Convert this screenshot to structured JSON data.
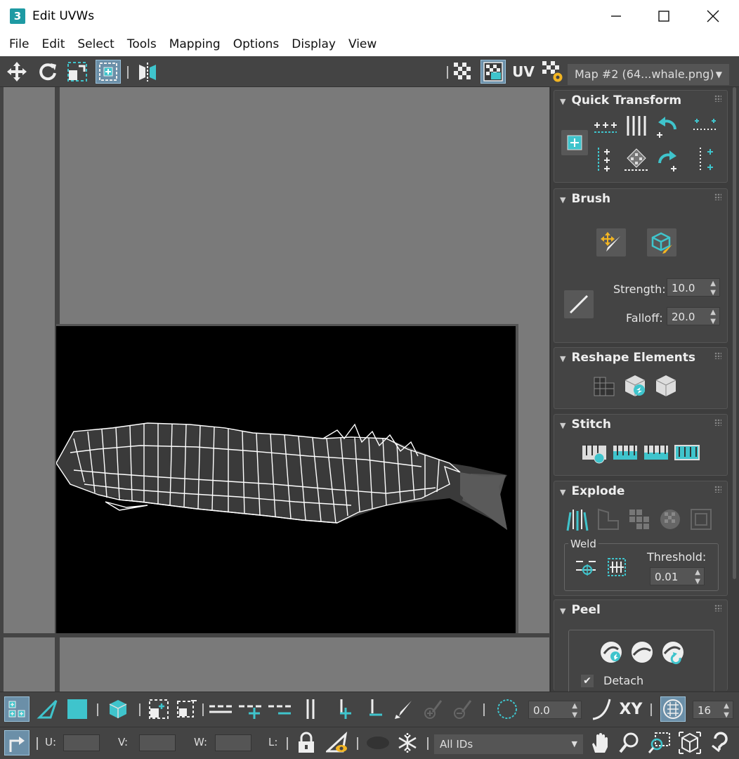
{
  "window": {
    "app_icon": "3",
    "title": "Edit UVWs",
    "controls": [
      "minimize-icon",
      "maximize-icon",
      "close-icon"
    ]
  },
  "menu": [
    "File",
    "Edit",
    "Select",
    "Tools",
    "Mapping",
    "Options",
    "Display",
    "View"
  ],
  "toolbar_top": {
    "tools": [
      "move-icon",
      "rotate-icon",
      "scale-icon",
      "freeform-icon",
      "mirror-icon"
    ],
    "uv_label": "UV",
    "map_select": "Map #2 (64...whale.png)"
  },
  "panel": {
    "quick_transform": {
      "title": "Quick Transform"
    },
    "brush": {
      "title": "Brush",
      "strength_label": "Strength:",
      "strength_value": "10.0",
      "falloff_label": "Falloff:",
      "falloff_value": "20.0"
    },
    "reshape": {
      "title": "Reshape Elements"
    },
    "stitch": {
      "title": "Stitch"
    },
    "explode": {
      "title": "Explode",
      "weld_label": "Weld",
      "threshold_label": "Threshold:",
      "threshold_value": "0.01"
    },
    "peel": {
      "title": "Peel",
      "detach_label": "Detach",
      "detach_checked": true
    }
  },
  "bottom_toolbar": {
    "angle_value": "0.0",
    "xy_label": "XY",
    "grid_value": "16",
    "u_label": "U:",
    "v_label": "V:",
    "w_label": "W:",
    "l_label": "L:",
    "ids_select": "All IDs"
  },
  "colors": {
    "accent_teal": "#3fc4cc",
    "toolbar_bg": "#444444",
    "viewport_bg": "#7a7a7a",
    "texture_bg": "#000000",
    "active_button": "#6b8fa8"
  }
}
